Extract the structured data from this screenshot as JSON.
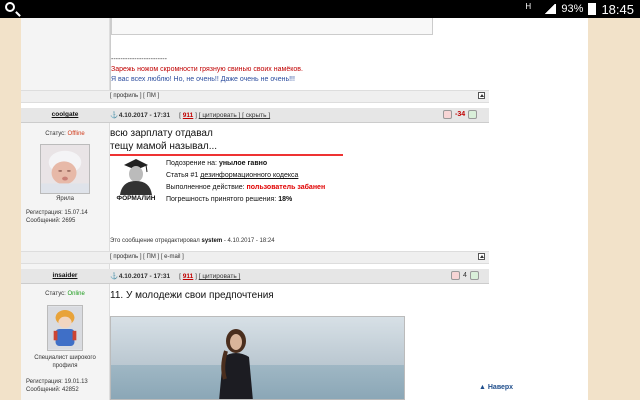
{
  "statusbar": {
    "battery": "93%",
    "time": "18:45"
  },
  "post0": {
    "signature_dash": "------------------------",
    "signature_red": "Зарежь ножом скромности грязную свинью своих намёков.",
    "signature_blue": "Я вас всех люблю! Но, не очень!! Даже очень не очень!!!"
  },
  "bar0": {
    "links": "[ профиль ] [ ПМ ]"
  },
  "post1": {
    "user": "coolgate",
    "date": "4.10.2017 - 17:31",
    "num": "911",
    "actions": "[ цитировать ] [ скрыть ]",
    "rep": "-34",
    "status_label": "Статус: ",
    "status_value": "Offline",
    "avatar_name": "Ярила",
    "reg": "Регистрация: 15.07.14",
    "msgs": "Сообщений: 2695",
    "text1": "всю зарплату отдавал",
    "text2": "тещу мамой называл...",
    "judge_label": "ФОРМАЛИН",
    "v1_label": "Подозрение на: ",
    "v1_value": "унылое гавно",
    "v2_label": "Статья #1 ",
    "v2_value": "дезинформационного кодекса",
    "v3_label": "Выполненное действие: ",
    "v3_value": "пользователь забанен",
    "v4_label": "Погрешность принятого решения: ",
    "v4_value": "18%",
    "edited_prefix": "Это сообщение отредактировал ",
    "edited_user": "system",
    "edited_suffix": " - 4.10.2017 - 18:24"
  },
  "bar1": {
    "links": "[ профиль ] [ ПМ ] [ e-mail ]"
  },
  "post2": {
    "user": "insaider",
    "date": "4.10.2017 - 17:31",
    "num": "911",
    "actions": "[ цитировать ]",
    "rep": "4",
    "status_label": "Статус: ",
    "status_value": "Online",
    "avatar_name_1": "Специалист широкого",
    "avatar_name_2": "профиля",
    "reg": "Регистрация: 19.01.13",
    "msgs": "Сообщений: 42852",
    "text": "11. У молодежи свои предпочтения"
  },
  "nav": {
    "top": "▲ Наверх"
  },
  "colors": {
    "accent_red": "#c00000",
    "online": "#1a9a1a",
    "offline": "#d03a1a",
    "link_blue": "#2c4d9e"
  }
}
